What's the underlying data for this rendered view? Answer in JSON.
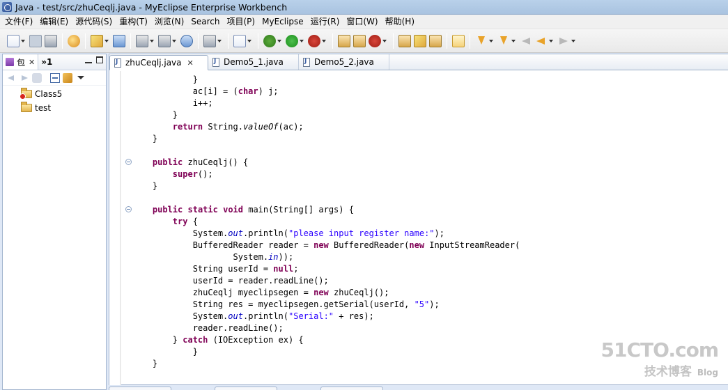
{
  "window": {
    "title": "Java - test/src/zhuCeqlj.java - MyEclipse Enterprise Workbench"
  },
  "menu": [
    "文件(F)",
    "编辑(E)",
    "源代码(S)",
    "重构(T)",
    "浏览(N)",
    "Search",
    "项目(P)",
    "MyEclipse",
    "运行(R)",
    "窗口(W)",
    "帮助(H)"
  ],
  "toolbar_icons": [
    "new-icon",
    "save-icon",
    "print-icon",
    "java-icon",
    "wizard-icon",
    "deploy-icon",
    "server-icon",
    "browser-icon",
    "camera-icon",
    "new-class-icon",
    "debug-icon",
    "run-icon",
    "external-tools-icon",
    "open-type-icon",
    "open-task-icon",
    "search-icon",
    "mark-occurrences-icon",
    "next-annotation-icon",
    "back-icon",
    "forward-icon"
  ],
  "left_panel": {
    "tab_label": "包",
    "second_tab_label": "»1",
    "tree": [
      {
        "label": "Class5",
        "error": true
      },
      {
        "label": "test",
        "error": false
      }
    ]
  },
  "editor": {
    "tabs": [
      {
        "label": "zhuCeqlj.java",
        "active": true
      },
      {
        "label": "Demo5_1.java",
        "active": false
      },
      {
        "label": "Demo5_2.java",
        "active": false
      }
    ],
    "folds": [
      6,
      10
    ]
  },
  "watermark": {
    "logo": "51CTO.com",
    "sub": "技术博客",
    "blog": "Blog"
  }
}
